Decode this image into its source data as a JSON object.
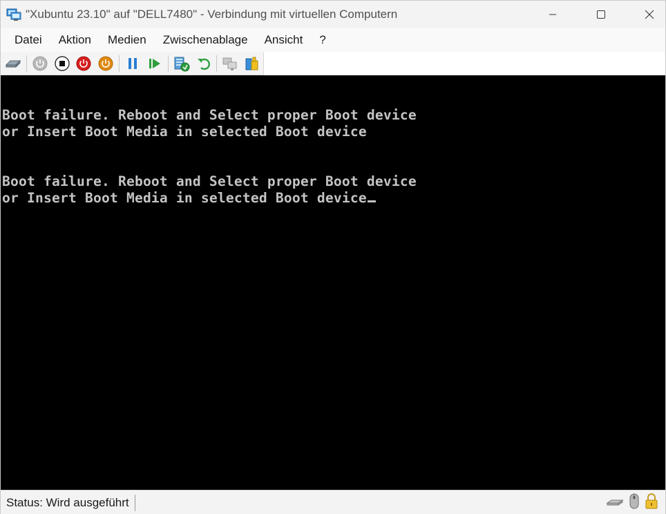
{
  "window": {
    "title": "\"Xubuntu 23.10\" auf \"DELL7480\" - Verbindung mit virtuellen Computern"
  },
  "menu": {
    "items": [
      "Datei",
      "Aktion",
      "Medien",
      "Zwischenablage",
      "Ansicht",
      "?"
    ]
  },
  "toolbar": {
    "buttons": [
      {
        "icon": "ctrl-alt-del-icon"
      },
      {
        "icon": "start-icon"
      },
      {
        "icon": "turn-off-icon"
      },
      {
        "icon": "shutdown-icon"
      },
      {
        "icon": "save-icon"
      },
      {
        "icon": "pause-icon"
      },
      {
        "icon": "resume-icon"
      },
      {
        "icon": "checkpoint-icon"
      },
      {
        "icon": "revert-icon"
      },
      {
        "icon": "enhanced-session-icon"
      },
      {
        "icon": "share-icon"
      }
    ]
  },
  "console": {
    "lines": [
      "Boot failure. Reboot and Select proper Boot device",
      "or Insert Boot Media in selected Boot device",
      "Boot failure. Reboot and Select proper Boot device",
      "or Insert Boot Media in selected Boot device"
    ],
    "text_color": "#c4c4c4",
    "background": "#000000"
  },
  "status": {
    "text": "Status: Wird ausgeführt"
  },
  "colors": {
    "stop_red": "#d81e1e",
    "shutdown_orange": "#e08a10",
    "pause_blue": "#2a7fd4",
    "resume_green": "#2e9e3e"
  }
}
